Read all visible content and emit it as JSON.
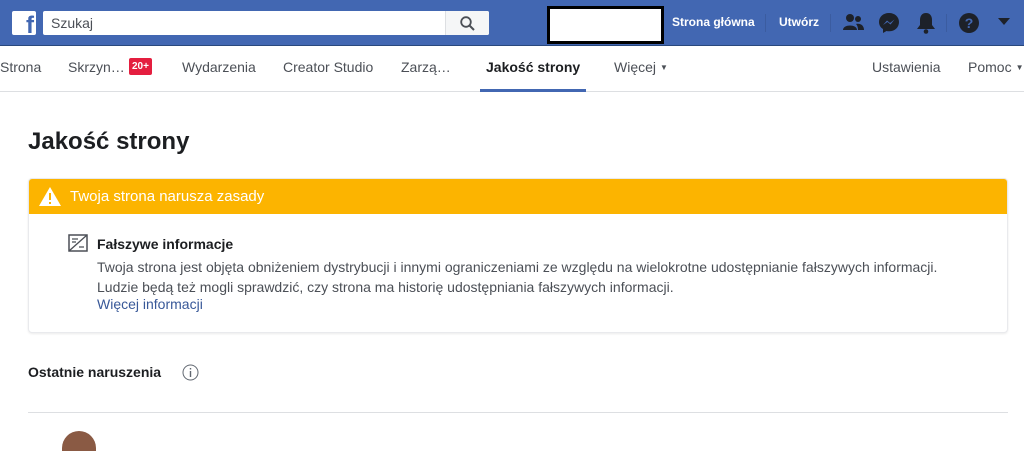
{
  "topbar": {
    "logo_letter": "f",
    "search_placeholder": "Szukaj",
    "links": {
      "home": "Strona główna",
      "create": "Utwórz"
    }
  },
  "subnav": {
    "items": [
      "Strona",
      "Skrzyn…",
      "Wydarzenia",
      "Creator Studio",
      "Zarzą…",
      "Jakość strony",
      "Więcej"
    ],
    "inbox_badge": "20+",
    "right": {
      "settings": "Ustawienia",
      "help": "Pomoc"
    }
  },
  "main": {
    "title": "Jakość strony",
    "alert": {
      "header": "Twoja strona narusza zasady",
      "violation_title": "Fałszywe informacje",
      "description_line1": "Twoja strona jest objęta obniżeniem dystrybucji i innymi ograniczeniami ze względu na wielokrotne udostępnianie fałszywych informacji.",
      "description_line2": "Ludzie będą też mogli sprawdzić, czy strona ma historię udostępniania fałszywych informacji.",
      "more_link": "Więcej informacji"
    },
    "recent_violations": "Ostatnie naruszenia"
  },
  "colors": {
    "brand": "#4267b2",
    "warning": "#fcb400",
    "link": "#385898",
    "badge": "#e41e3f"
  }
}
